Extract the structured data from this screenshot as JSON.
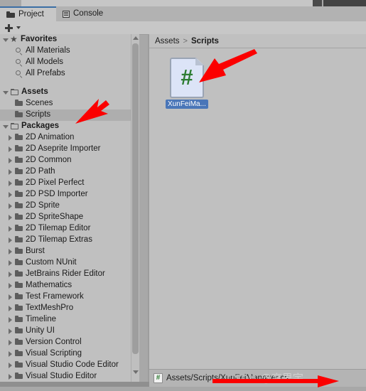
{
  "window": {
    "tabs": [
      {
        "label": "Project",
        "icon": "folder-icon",
        "active": true
      },
      {
        "label": "Console",
        "icon": "console-icon",
        "active": false
      }
    ],
    "toolbar": {
      "add_label": "+",
      "dropdown_icon": "chevron-down-icon"
    }
  },
  "tree": {
    "groups": [
      {
        "label": "Favorites",
        "icon": "star-icon",
        "twisty": "down",
        "indent": 0,
        "children": [
          {
            "label": "All Materials",
            "icon": "search-icon",
            "indent": 1
          },
          {
            "label": "All Models",
            "icon": "search-icon",
            "indent": 1
          },
          {
            "label": "All Prefabs",
            "icon": "search-icon",
            "indent": 1
          }
        ]
      },
      {
        "label": "Assets",
        "icon": "folder-open-icon",
        "twisty": "down",
        "indent": 0,
        "children": [
          {
            "label": "Scenes",
            "icon": "folder-icon",
            "indent": 1
          },
          {
            "label": "Scripts",
            "icon": "folder-icon",
            "indent": 1,
            "selected": true
          }
        ]
      },
      {
        "label": "Packages",
        "icon": "folder-open-icon",
        "twisty": "down",
        "indent": 0,
        "children": [
          {
            "label": "2D Animation",
            "icon": "folder-icon",
            "indent": 1,
            "twisty": "right"
          },
          {
            "label": "2D Aseprite Importer",
            "icon": "folder-icon",
            "indent": 1,
            "twisty": "right"
          },
          {
            "label": "2D Common",
            "icon": "folder-icon",
            "indent": 1,
            "twisty": "right"
          },
          {
            "label": "2D Path",
            "icon": "folder-icon",
            "indent": 1,
            "twisty": "right"
          },
          {
            "label": "2D Pixel Perfect",
            "icon": "folder-icon",
            "indent": 1,
            "twisty": "right"
          },
          {
            "label": "2D PSD Importer",
            "icon": "folder-icon",
            "indent": 1,
            "twisty": "right"
          },
          {
            "label": "2D Sprite",
            "icon": "folder-icon",
            "indent": 1,
            "twisty": "right"
          },
          {
            "label": "2D SpriteShape",
            "icon": "folder-icon",
            "indent": 1,
            "twisty": "right"
          },
          {
            "label": "2D Tilemap Editor",
            "icon": "folder-icon",
            "indent": 1,
            "twisty": "right"
          },
          {
            "label": "2D Tilemap Extras",
            "icon": "folder-icon",
            "indent": 1,
            "twisty": "right"
          },
          {
            "label": "Burst",
            "icon": "folder-icon",
            "indent": 1,
            "twisty": "right"
          },
          {
            "label": "Custom NUnit",
            "icon": "folder-icon",
            "indent": 1,
            "twisty": "right"
          },
          {
            "label": "JetBrains Rider Editor",
            "icon": "folder-icon",
            "indent": 1,
            "twisty": "right"
          },
          {
            "label": "Mathematics",
            "icon": "folder-icon",
            "indent": 1,
            "twisty": "right"
          },
          {
            "label": "Test Framework",
            "icon": "folder-icon",
            "indent": 1,
            "twisty": "right"
          },
          {
            "label": "TextMeshPro",
            "icon": "folder-icon",
            "indent": 1,
            "twisty": "right"
          },
          {
            "label": "Timeline",
            "icon": "folder-icon",
            "indent": 1,
            "twisty": "right"
          },
          {
            "label": "Unity UI",
            "icon": "folder-icon",
            "indent": 1,
            "twisty": "right"
          },
          {
            "label": "Version Control",
            "icon": "folder-icon",
            "indent": 1,
            "twisty": "right"
          },
          {
            "label": "Visual Scripting",
            "icon": "folder-icon",
            "indent": 1,
            "twisty": "right"
          },
          {
            "label": "Visual Studio Code Editor",
            "icon": "folder-icon",
            "indent": 1,
            "twisty": "right"
          },
          {
            "label": "Visual Studio Editor",
            "icon": "folder-icon",
            "indent": 1,
            "twisty": "right"
          }
        ]
      }
    ]
  },
  "breadcrumb": {
    "root": "Assets",
    "separator": ">",
    "current": "Scripts"
  },
  "assets": [
    {
      "name": "XunFeiMa...",
      "type": "csharp-script",
      "glyph": "#",
      "selected": true
    }
  ],
  "status": {
    "icon": "csharp-script-icon",
    "path": "Assets/Scripts/XunFeiManager.cs"
  },
  "watermark": {
    "site": "CSDN",
    "author": "@高思宇"
  },
  "colors": {
    "panel_bg": "#c0c0c0",
    "tabbar_bg": "#b2b2b2",
    "active_tab_bg": "#c7c7c7",
    "tab_accent": "#3b6ea5",
    "selection_row": "#aeaeae",
    "selection_label": "#4a76b8",
    "script_green": "#2e7d32",
    "script_page": "#dce4f7",
    "annotation_red": "#fb0000"
  },
  "annotations": [
    {
      "name": "arrow-to-scripts-folder",
      "color": "#fb0000"
    },
    {
      "name": "arrow-to-script-asset",
      "color": "#fb0000"
    },
    {
      "name": "arrow-to-status-path",
      "color": "#fb0000"
    }
  ]
}
